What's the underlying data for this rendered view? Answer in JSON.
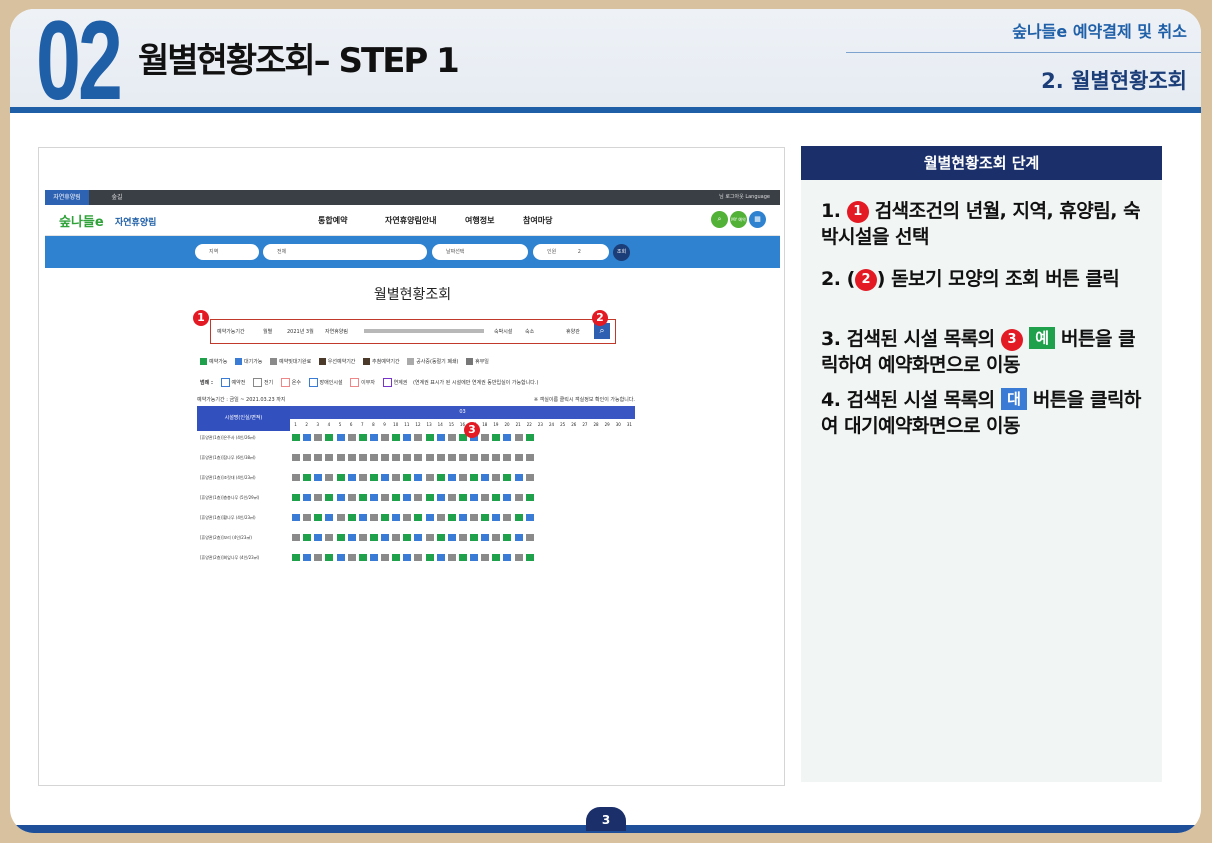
{
  "header": {
    "number": "02",
    "title": "월별현황조회– STEP 1",
    "course": "숲나들e 예약결제 및 취소",
    "section": "2. 월별현황조회"
  },
  "screenshot": {
    "top_tab_active": "자연휴양림",
    "top_tab_2": "숲길",
    "top_right": "님  로그아웃  Language",
    "logo": "숲나들e",
    "logo_sub": "자연휴양림",
    "menu": [
      "통합예약",
      "자연휴양림안내",
      "여행정보",
      "참여마당"
    ],
    "icon_labels": [
      "",
      "MY 예약",
      ""
    ],
    "search": {
      "region": "지역",
      "all": "전체",
      "date": "날짜선택",
      "people_label": "인원",
      "people_count": "2",
      "btn": "조회"
    },
    "page_title": "월별현황조회",
    "filter": {
      "opt1": "예약가능기간",
      "opt2": "월별",
      "month": "2021년 3월",
      "region": "자연휴양림",
      "facility_label": "숙박시설",
      "facility_val": "숙소",
      "extra": "휴양관"
    },
    "legend1": [
      "예약가능",
      "대기가능",
      "예약및대기완료",
      "우선예약기간",
      "추첨예약기간",
      "공사중(동절기 폐쇄)",
      "휴무일"
    ],
    "legend2_title": "범례 :",
    "legend2": [
      "예약전",
      "전기",
      "온수",
      "장애인시설",
      "이부자",
      "연계권"
    ],
    "legend2_note": "(연계권 표시가 된 시설에만 연계권 동반입실이 가능합니다.)",
    "period": "예약가능기간 : 금일 ~ 2021.03.23 까지",
    "period_note": "※ 객실이름 클릭시 객실정보 확인이 가능합니다.",
    "col_header": "시설명(인실/면적)",
    "month_num": "03",
    "days": [
      "1",
      "2",
      "3",
      "4",
      "5",
      "6",
      "7",
      "8",
      "9",
      "10",
      "11",
      "12",
      "13",
      "14",
      "15",
      "16",
      "17",
      "18",
      "19",
      "20",
      "21",
      "22",
      "23",
      "24",
      "25",
      "26",
      "27",
      "28",
      "29",
      "30",
      "31"
    ],
    "rows": [
      "[휴양관(1층)]은주사 (4인/26㎡)",
      "[휴양관(1층)]참나무 (6인/38㎡)",
      "[휴양관(1층)]조릿대 (4인/23㎡)",
      "[휴양관(1층)]층층나무 (5인/29㎡)",
      "[휴양관(1층)]황나무 (4인/23㎡)",
      "[휴양관(2층)]꼬리 (4인/23㎡)",
      "[휴양관(2층)]회잎나무 (4인/23㎡)"
    ]
  },
  "panel": {
    "title": "월별현황조회 단계",
    "step1_num": "1.",
    "step1_badge": "1",
    "step1_text": "검색조건의 년월, 지역, 휴양림, 숙박시설을 선택",
    "step2_num": "2.",
    "step2_pre": "(",
    "step2_badge": "2",
    "step2_text": ") 돋보기 모양의 조회 버튼 클릭",
    "step3_num": "3.",
    "step3_pre": "검색된 시설 목록의",
    "step3_badge": "3",
    "step3_chip": "예",
    "step3_text": "버튼을 클릭하여 예약화면으로 이동",
    "step4_num": "4.",
    "step4_pre": "검색된 시설 목록의",
    "step4_chip": "대",
    "step4_text": "버튼을 클릭하여 대기예약화면으로 이동"
  },
  "markers": {
    "m1": "1",
    "m2": "2",
    "m3": "3"
  },
  "footer": {
    "page": "3"
  },
  "colors": {
    "brand": "#1f5fa8",
    "navy": "#1b2f6b",
    "red": "#e31a23",
    "green": "#1fa04a",
    "blue": "#3a7bd5"
  }
}
